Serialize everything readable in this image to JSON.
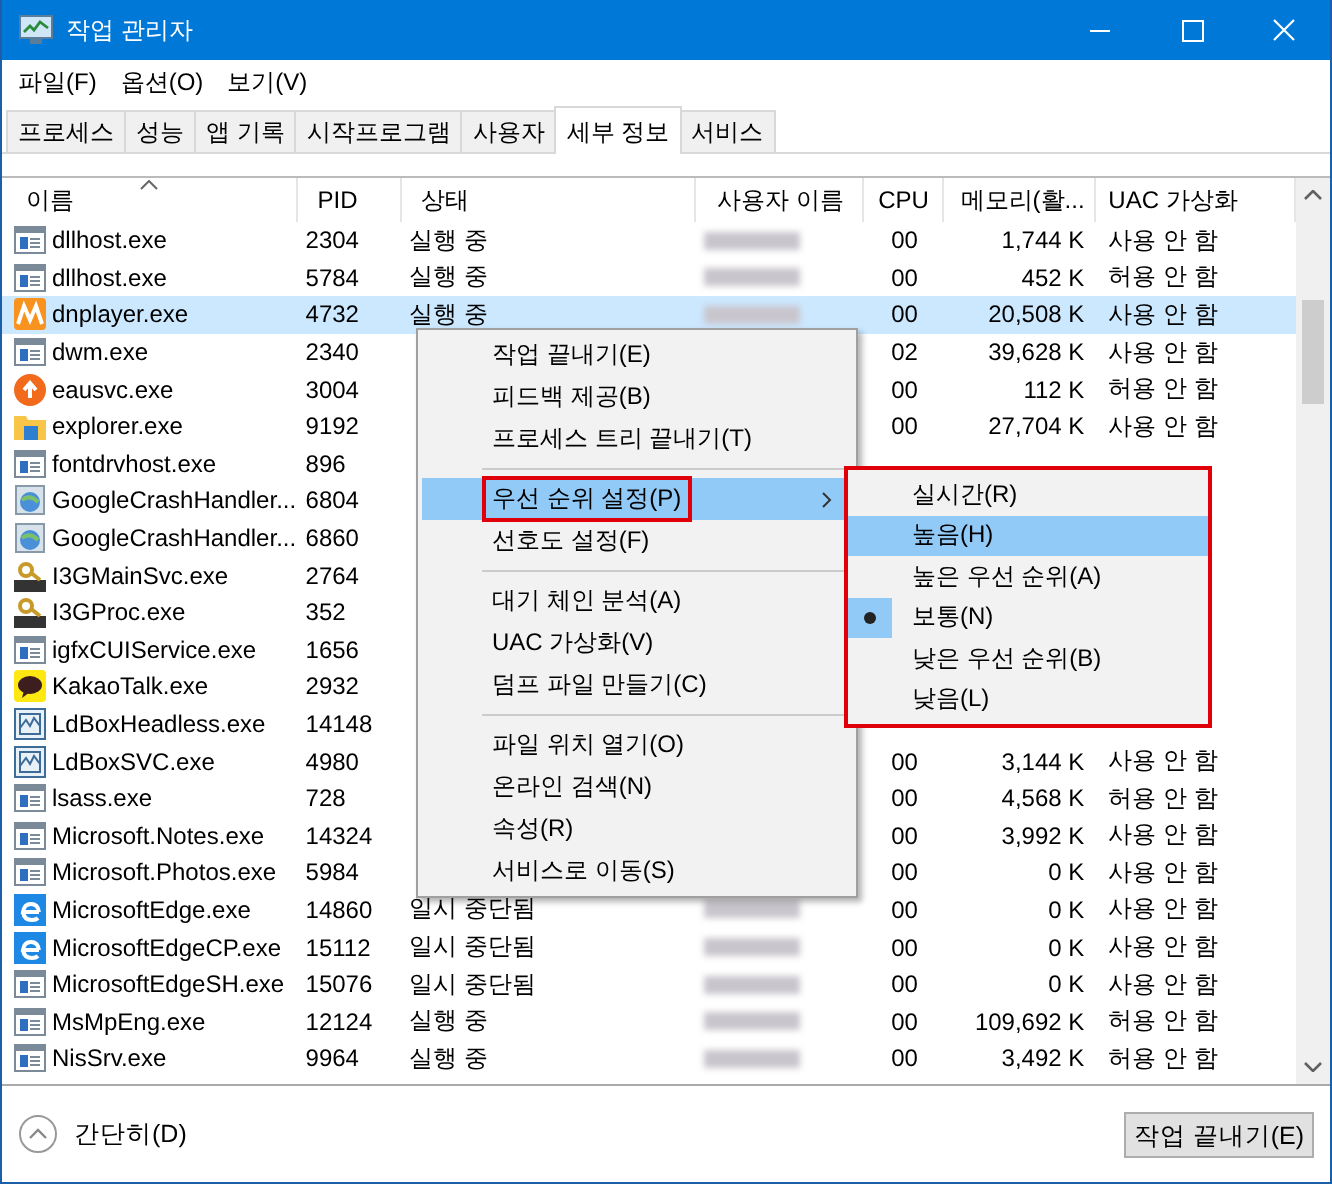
{
  "window": {
    "title": "작업 관리자"
  },
  "menu": [
    "파일(F)",
    "옵션(O)",
    "보기(V)"
  ],
  "tabs": [
    {
      "label": "프로세스",
      "selected": false
    },
    {
      "label": "성능",
      "selected": false
    },
    {
      "label": "앱 기록",
      "selected": false
    },
    {
      "label": "시작프로그램",
      "selected": false
    },
    {
      "label": "사용자",
      "selected": false
    },
    {
      "label": "세부 정보",
      "selected": true
    },
    {
      "label": "서비스",
      "selected": false
    }
  ],
  "table": {
    "columns": [
      "이름",
      "PID",
      "상태",
      "사용자 이름",
      "CPU",
      "메모리(활...",
      "UAC 가상화"
    ],
    "rows": [
      {
        "kind": "window",
        "name": "dllhost.exe",
        "pid": "2304",
        "status": "실행 중",
        "user_blurred": true,
        "cpu": "00",
        "mem": "1,744 K",
        "uac": "사용 안 함",
        "selected": false
      },
      {
        "kind": "window",
        "name": "dllhost.exe",
        "pid": "5784",
        "status": "실행 중",
        "user_blurred": true,
        "cpu": "00",
        "mem": "452 K",
        "uac": "허용 안 함",
        "selected": false
      },
      {
        "kind": "player",
        "name": "dnplayer.exe",
        "pid": "4732",
        "status": "실행 중",
        "user_blurred": true,
        "cpu": "00",
        "mem": "20,508 K",
        "uac": "사용 안 함",
        "selected": true
      },
      {
        "kind": "window",
        "name": "dwm.exe",
        "pid": "2340",
        "cpu": "02",
        "mem": "39,628 K",
        "uac": "사용 안 함",
        "selected": false
      },
      {
        "kind": "update",
        "name": "eausvc.exe",
        "pid": "3004",
        "cpu": "00",
        "mem": "112 K",
        "uac": "허용 안 함",
        "selected": false
      },
      {
        "kind": "folder",
        "name": "explorer.exe",
        "pid": "9192",
        "cpu": "00",
        "mem": "27,704 K",
        "uac": "사용 안 함",
        "selected": false
      },
      {
        "kind": "window",
        "name": "fontdrvhost.exe",
        "pid": "896",
        "selected": false
      },
      {
        "kind": "globe",
        "name": "GoogleCrashHandler...",
        "pid": "6804",
        "selected": false
      },
      {
        "kind": "globe",
        "name": "GoogleCrashHandler...",
        "pid": "6860",
        "selected": false
      },
      {
        "kind": "key",
        "name": "I3GMainSvc.exe",
        "pid": "2764",
        "selected": false
      },
      {
        "kind": "key",
        "name": "I3GProc.exe",
        "pid": "352",
        "selected": false
      },
      {
        "kind": "window",
        "name": "igfxCUIService.exe",
        "pid": "1656",
        "selected": false
      },
      {
        "kind": "chat",
        "name": "KakaoTalk.exe",
        "pid": "2932",
        "selected": false
      },
      {
        "kind": "monitor",
        "name": "LdBoxHeadless.exe",
        "pid": "14148",
        "selected": false
      },
      {
        "kind": "monitor",
        "name": "LdBoxSVC.exe",
        "pid": "4980",
        "cpu": "00",
        "mem": "3,144 K",
        "uac": "사용 안 함",
        "selected": false
      },
      {
        "kind": "window",
        "name": "lsass.exe",
        "pid": "728",
        "cpu": "00",
        "mem": "4,568 K",
        "uac": "허용 안 함",
        "selected": false
      },
      {
        "kind": "window",
        "name": "Microsoft.Notes.exe",
        "pid": "14324",
        "cpu": "00",
        "mem": "3,992 K",
        "uac": "사용 안 함",
        "selected": false
      },
      {
        "kind": "window",
        "name": "Microsoft.Photos.exe",
        "pid": "5984",
        "cpu": "00",
        "mem": "0 K",
        "uac": "사용 안 함",
        "selected": false
      },
      {
        "kind": "edge",
        "name": "MicrosoftEdge.exe",
        "pid": "14860",
        "status": "일시 중단됨",
        "user_blurred": true,
        "cpu": "00",
        "mem": "0 K",
        "uac": "사용 안 함",
        "selected": false
      },
      {
        "kind": "edge",
        "name": "MicrosoftEdgeCP.exe",
        "pid": "15112",
        "status": "일시 중단됨",
        "user_blurred": true,
        "cpu": "00",
        "mem": "0 K",
        "uac": "사용 안 함",
        "selected": false
      },
      {
        "kind": "window",
        "name": "MicrosoftEdgeSH.exe",
        "pid": "15076",
        "status": "일시 중단됨",
        "user_blurred": true,
        "cpu": "00",
        "mem": "0 K",
        "uac": "사용 안 함",
        "selected": false
      },
      {
        "kind": "window",
        "name": "MsMpEng.exe",
        "pid": "12124",
        "status": "실행 중",
        "user_blurred": true,
        "cpu": "00",
        "mem": "109,692 K",
        "uac": "허용 안 함",
        "selected": false
      },
      {
        "kind": "window",
        "name": "NisSrv.exe",
        "pid": "9964",
        "status": "실행 중",
        "user_blurred": true,
        "cpu": "00",
        "mem": "3,492 K",
        "uac": "허용 안 함",
        "selected": false
      }
    ]
  },
  "context_menu": [
    {
      "kind": "item",
      "label": "작업 끝내기(E)",
      "highlighted": false,
      "outlined": false,
      "submenu": false
    },
    {
      "kind": "item",
      "label": "피드백 제공(B)",
      "highlighted": false,
      "outlined": false,
      "submenu": false
    },
    {
      "kind": "item",
      "label": "프로세스 트리 끝내기(T)",
      "highlighted": false,
      "outlined": false,
      "submenu": false
    },
    {
      "kind": "separator"
    },
    {
      "kind": "item",
      "label": "우선 순위 설정(P)",
      "highlighted": true,
      "outlined": true,
      "submenu": true
    },
    {
      "kind": "item",
      "label": "선호도 설정(F)",
      "highlighted": false,
      "outlined": false,
      "submenu": false
    },
    {
      "kind": "separator"
    },
    {
      "kind": "item",
      "label": "대기 체인 분석(A)",
      "highlighted": false,
      "outlined": false,
      "submenu": false
    },
    {
      "kind": "item",
      "label": "UAC 가상화(V)",
      "highlighted": false,
      "outlined": false,
      "submenu": false
    },
    {
      "kind": "item",
      "label": "덤프 파일 만들기(C)",
      "highlighted": false,
      "outlined": false,
      "submenu": false
    },
    {
      "kind": "separator"
    },
    {
      "kind": "item",
      "label": "파일 위치 열기(O)",
      "highlighted": false,
      "outlined": false,
      "submenu": false
    },
    {
      "kind": "item",
      "label": "온라인 검색(N)",
      "highlighted": false,
      "outlined": false,
      "submenu": false
    },
    {
      "kind": "item",
      "label": "속성(R)",
      "highlighted": false,
      "outlined": false,
      "submenu": false
    },
    {
      "kind": "item",
      "label": "서비스로 이동(S)",
      "highlighted": false,
      "outlined": false,
      "submenu": false
    }
  ],
  "priority_submenu": {
    "outlined": true,
    "items": [
      {
        "label": "실시간(R)",
        "highlighted": false,
        "selected": false
      },
      {
        "label": "높음(H)",
        "highlighted": true,
        "selected": false
      },
      {
        "label": "높은 우선 순위(A)",
        "highlighted": false,
        "selected": false
      },
      {
        "label": "보통(N)",
        "highlighted": false,
        "selected": true
      },
      {
        "label": "낮은 우선 순위(B)",
        "highlighted": false,
        "selected": false
      },
      {
        "label": "낮음(L)",
        "highlighted": false,
        "selected": false
      }
    ]
  },
  "footer": {
    "collapse_label": "간단히(D)",
    "end_task_button": "작업 끝내기(E)"
  }
}
